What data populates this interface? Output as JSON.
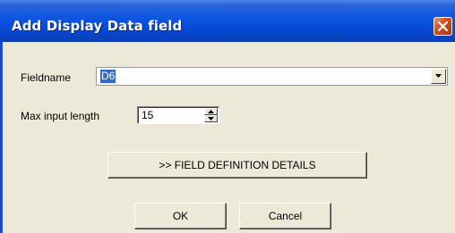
{
  "window": {
    "title": "Add Display Data field"
  },
  "form": {
    "fieldname_label": "Fieldname",
    "fieldname_value": "D6",
    "max_input_length_label": "Max input length",
    "max_input_length_value": "15"
  },
  "buttons": {
    "details_label": ">> FIELD DEFINITION DETAILS",
    "ok_label": "OK",
    "cancel_label": "Cancel"
  },
  "icons": {
    "close": "close-icon",
    "dropdown": "chevron-down-icon",
    "spin_up": "spin-up-icon",
    "spin_down": "spin-down-icon"
  },
  "colors": {
    "titlebar": "#0b55e1",
    "dialog_background": "#ece9d8",
    "selection": "#316ac5",
    "close_button": "#d9552a"
  }
}
